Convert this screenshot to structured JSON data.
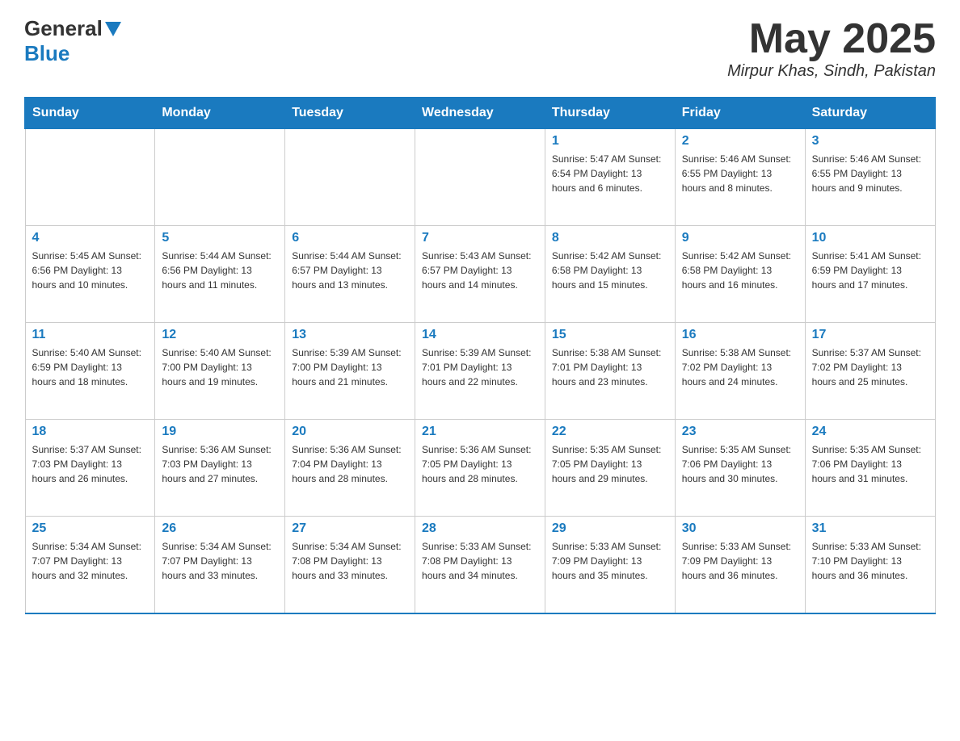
{
  "header": {
    "logo_general": "General",
    "logo_blue": "Blue",
    "month_title": "May 2025",
    "location": "Mirpur Khas, Sindh, Pakistan"
  },
  "calendar": {
    "days_of_week": [
      "Sunday",
      "Monday",
      "Tuesday",
      "Wednesday",
      "Thursday",
      "Friday",
      "Saturday"
    ],
    "weeks": [
      [
        {
          "day": "",
          "info": ""
        },
        {
          "day": "",
          "info": ""
        },
        {
          "day": "",
          "info": ""
        },
        {
          "day": "",
          "info": ""
        },
        {
          "day": "1",
          "info": "Sunrise: 5:47 AM\nSunset: 6:54 PM\nDaylight: 13 hours and 6 minutes."
        },
        {
          "day": "2",
          "info": "Sunrise: 5:46 AM\nSunset: 6:55 PM\nDaylight: 13 hours and 8 minutes."
        },
        {
          "day": "3",
          "info": "Sunrise: 5:46 AM\nSunset: 6:55 PM\nDaylight: 13 hours and 9 minutes."
        }
      ],
      [
        {
          "day": "4",
          "info": "Sunrise: 5:45 AM\nSunset: 6:56 PM\nDaylight: 13 hours and 10 minutes."
        },
        {
          "day": "5",
          "info": "Sunrise: 5:44 AM\nSunset: 6:56 PM\nDaylight: 13 hours and 11 minutes."
        },
        {
          "day": "6",
          "info": "Sunrise: 5:44 AM\nSunset: 6:57 PM\nDaylight: 13 hours and 13 minutes."
        },
        {
          "day": "7",
          "info": "Sunrise: 5:43 AM\nSunset: 6:57 PM\nDaylight: 13 hours and 14 minutes."
        },
        {
          "day": "8",
          "info": "Sunrise: 5:42 AM\nSunset: 6:58 PM\nDaylight: 13 hours and 15 minutes."
        },
        {
          "day": "9",
          "info": "Sunrise: 5:42 AM\nSunset: 6:58 PM\nDaylight: 13 hours and 16 minutes."
        },
        {
          "day": "10",
          "info": "Sunrise: 5:41 AM\nSunset: 6:59 PM\nDaylight: 13 hours and 17 minutes."
        }
      ],
      [
        {
          "day": "11",
          "info": "Sunrise: 5:40 AM\nSunset: 6:59 PM\nDaylight: 13 hours and 18 minutes."
        },
        {
          "day": "12",
          "info": "Sunrise: 5:40 AM\nSunset: 7:00 PM\nDaylight: 13 hours and 19 minutes."
        },
        {
          "day": "13",
          "info": "Sunrise: 5:39 AM\nSunset: 7:00 PM\nDaylight: 13 hours and 21 minutes."
        },
        {
          "day": "14",
          "info": "Sunrise: 5:39 AM\nSunset: 7:01 PM\nDaylight: 13 hours and 22 minutes."
        },
        {
          "day": "15",
          "info": "Sunrise: 5:38 AM\nSunset: 7:01 PM\nDaylight: 13 hours and 23 minutes."
        },
        {
          "day": "16",
          "info": "Sunrise: 5:38 AM\nSunset: 7:02 PM\nDaylight: 13 hours and 24 minutes."
        },
        {
          "day": "17",
          "info": "Sunrise: 5:37 AM\nSunset: 7:02 PM\nDaylight: 13 hours and 25 minutes."
        }
      ],
      [
        {
          "day": "18",
          "info": "Sunrise: 5:37 AM\nSunset: 7:03 PM\nDaylight: 13 hours and 26 minutes."
        },
        {
          "day": "19",
          "info": "Sunrise: 5:36 AM\nSunset: 7:03 PM\nDaylight: 13 hours and 27 minutes."
        },
        {
          "day": "20",
          "info": "Sunrise: 5:36 AM\nSunset: 7:04 PM\nDaylight: 13 hours and 28 minutes."
        },
        {
          "day": "21",
          "info": "Sunrise: 5:36 AM\nSunset: 7:05 PM\nDaylight: 13 hours and 28 minutes."
        },
        {
          "day": "22",
          "info": "Sunrise: 5:35 AM\nSunset: 7:05 PM\nDaylight: 13 hours and 29 minutes."
        },
        {
          "day": "23",
          "info": "Sunrise: 5:35 AM\nSunset: 7:06 PM\nDaylight: 13 hours and 30 minutes."
        },
        {
          "day": "24",
          "info": "Sunrise: 5:35 AM\nSunset: 7:06 PM\nDaylight: 13 hours and 31 minutes."
        }
      ],
      [
        {
          "day": "25",
          "info": "Sunrise: 5:34 AM\nSunset: 7:07 PM\nDaylight: 13 hours and 32 minutes."
        },
        {
          "day": "26",
          "info": "Sunrise: 5:34 AM\nSunset: 7:07 PM\nDaylight: 13 hours and 33 minutes."
        },
        {
          "day": "27",
          "info": "Sunrise: 5:34 AM\nSunset: 7:08 PM\nDaylight: 13 hours and 33 minutes."
        },
        {
          "day": "28",
          "info": "Sunrise: 5:33 AM\nSunset: 7:08 PM\nDaylight: 13 hours and 34 minutes."
        },
        {
          "day": "29",
          "info": "Sunrise: 5:33 AM\nSunset: 7:09 PM\nDaylight: 13 hours and 35 minutes."
        },
        {
          "day": "30",
          "info": "Sunrise: 5:33 AM\nSunset: 7:09 PM\nDaylight: 13 hours and 36 minutes."
        },
        {
          "day": "31",
          "info": "Sunrise: 5:33 AM\nSunset: 7:10 PM\nDaylight: 13 hours and 36 minutes."
        }
      ]
    ]
  }
}
